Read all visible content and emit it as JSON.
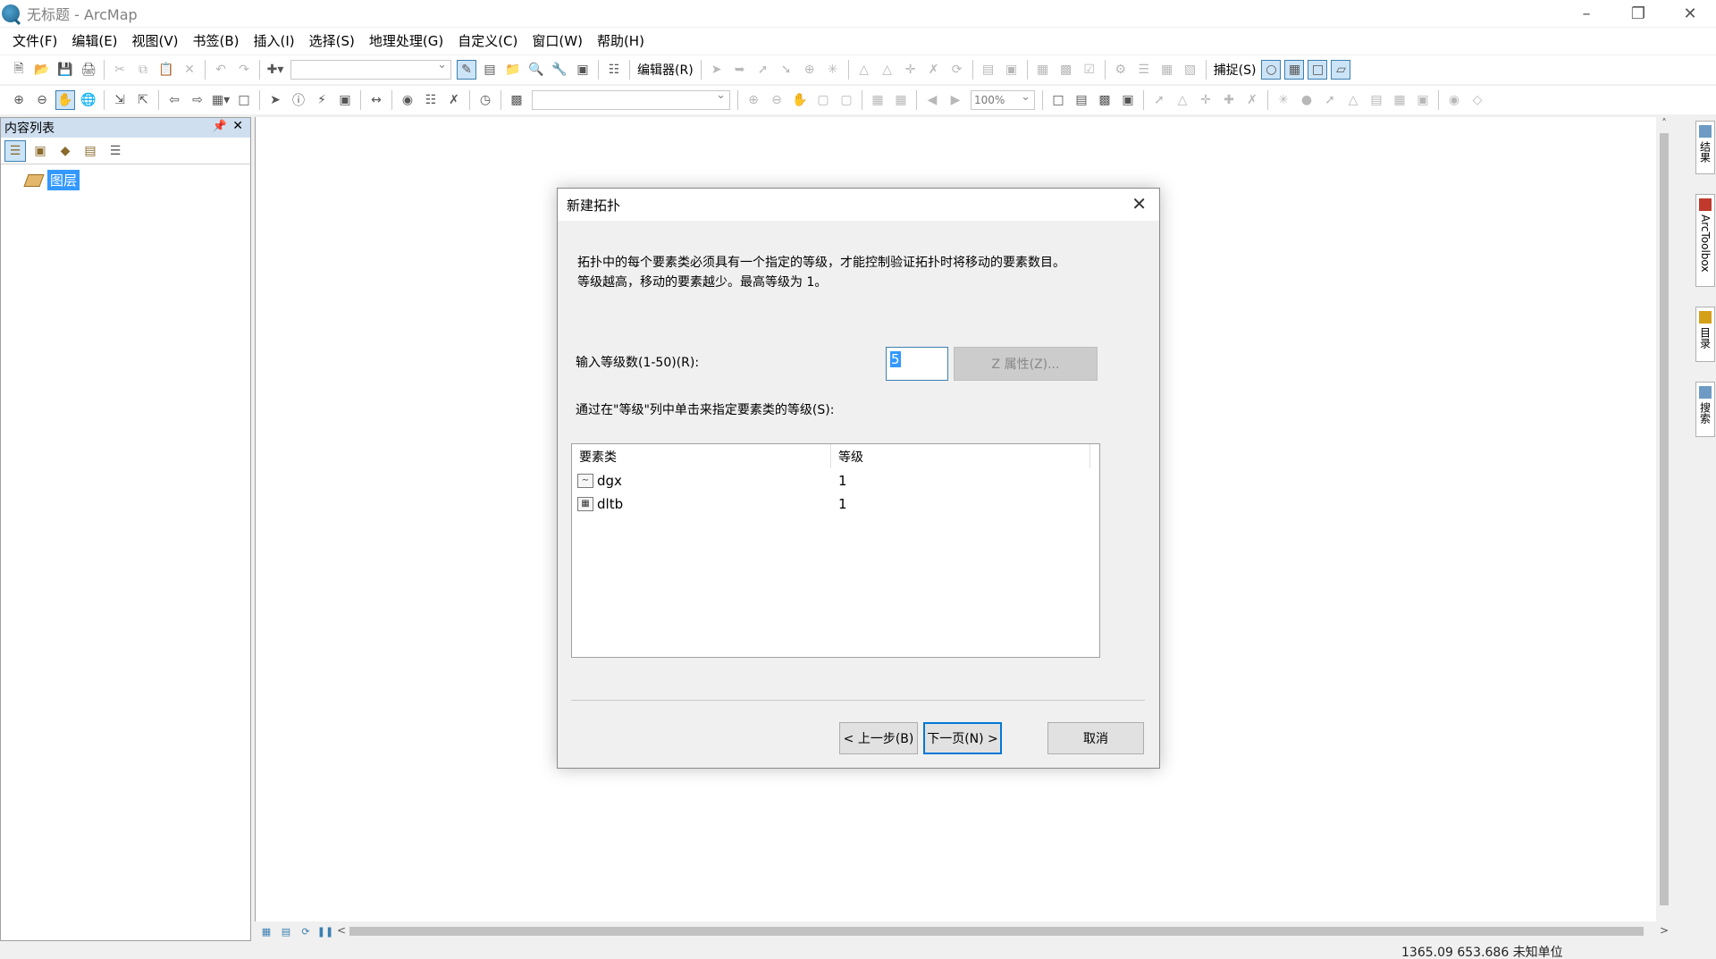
{
  "window": {
    "title": "无标题 - ArcMap"
  },
  "menu": [
    "文件(F)",
    "编辑(E)",
    "视图(V)",
    "书签(B)",
    "插入(I)",
    "选择(S)",
    "地理处理(G)",
    "自定义(C)",
    "窗口(W)",
    "帮助(H)"
  ],
  "toolbar": {
    "editor_label": "编辑器(R)",
    "snapping_label": "捕捉(S)",
    "zoom_value": "100%"
  },
  "toc": {
    "title": "内容列表",
    "layer_label": "图层"
  },
  "sidedock": {
    "tabs": [
      "结果",
      "ArcToolbox",
      "目录",
      "搜索"
    ]
  },
  "status": {
    "coordinates": "1365.09  653.686 未知单位"
  },
  "dialog": {
    "title": "新建拓扑",
    "description_line1": "拓扑中的每个要素类必须具有一个指定的等级，才能控制验证拓扑时将移动的要素数目。",
    "description_line2": "等级越高，移动的要素越少。最高等级为 1。",
    "levels_label": "输入等级数(1-50)(R):",
    "levels_value": "5",
    "z_properties_label": "Z 属性(Z)...",
    "assign_label": "通过在\"等级\"列中单击来指定要素类的等级(S):",
    "grid": {
      "headers": [
        "要素类",
        "等级"
      ],
      "rows": [
        {
          "name": "dgx",
          "rank": "1",
          "icon": "polyline-featureclass-icon"
        },
        {
          "name": "dltb",
          "rank": "1",
          "icon": "polygon-featureclass-icon"
        }
      ]
    },
    "back_label": "< 上一步(B)",
    "next_label": "下一页(N) >",
    "cancel_label": "取消"
  }
}
